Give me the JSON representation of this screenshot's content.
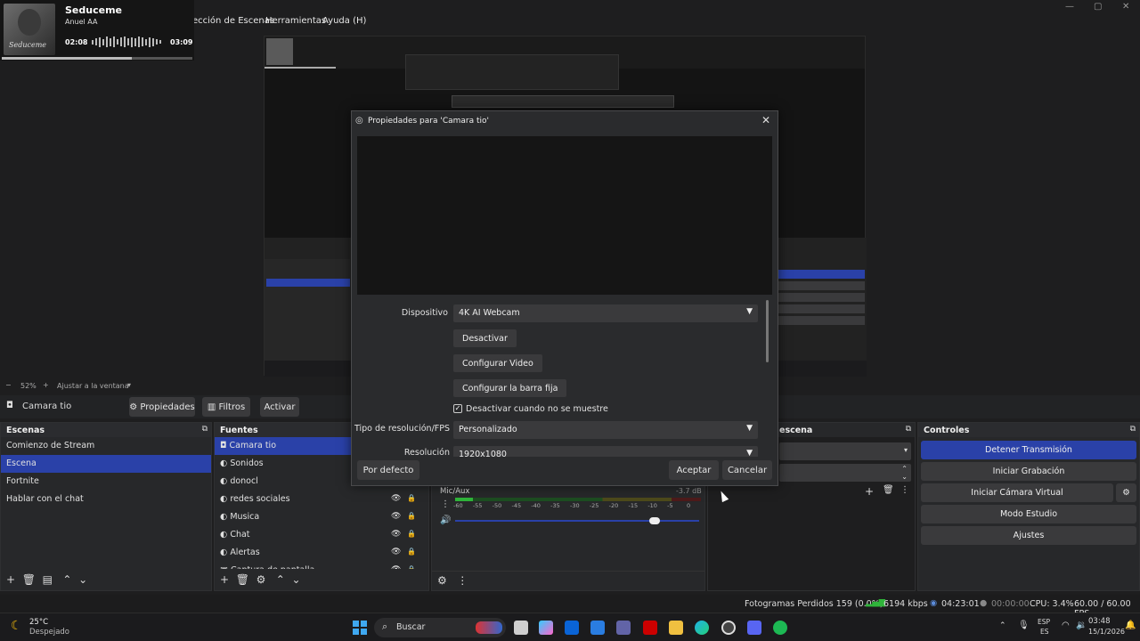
{
  "colors": {
    "accent": "#2a41a8",
    "bg": "#1e1e1f",
    "dock": "#27282a",
    "button": "#3a3a3c",
    "meter_green": "#2fb43a",
    "meter_yellow": "#c9b72b",
    "meter_red": "#c0392b"
  },
  "menubar": {
    "items": [
      "ección de Escenas",
      "Herramientas",
      "Ayuda (H)"
    ]
  },
  "music": {
    "title": "Seduceme",
    "artist": "Anuel AA",
    "elapsed": "02:08",
    "duration": "03:09",
    "progress": 0.68,
    "album_text": "Seduceme"
  },
  "preview": {
    "zoom": "52%",
    "fit_label": "Ajustar a la ventana"
  },
  "source_toolbar": {
    "source_name": "Camara tio",
    "properties": "Propiedades",
    "filters": "Filtros",
    "activate": "Activar"
  },
  "scenes": {
    "title": "Escenas",
    "items": [
      "Comienzo de Stream",
      "Escena",
      "Fortnite",
      "Hablar con el chat"
    ],
    "selected": 1
  },
  "sources": {
    "title": "Fuentes",
    "items": [
      "Camara tio",
      "Sonidos",
      "donocl",
      "redes sociales",
      "Musica",
      "Chat",
      "Alertas",
      "Captura de pantalla"
    ],
    "selected": 0
  },
  "mixer": {
    "channel": "Mic/Aux",
    "db": "-3.7 dB",
    "ticks": [
      "-60",
      "-55",
      "-50",
      "-45",
      "-40",
      "-35",
      "-30",
      "-25",
      "-20",
      "-15",
      "-10",
      "-5",
      "0"
    ]
  },
  "transitions": {
    "title": "escena"
  },
  "controls": {
    "title": "Controles",
    "buttons": [
      "Detener Transmisión",
      "Iniciar Grabación",
      "Iniciar Cámara Virtual",
      "Modo Estudio",
      "Ajustes"
    ]
  },
  "dialog": {
    "title": "Propiedades para 'Camara tio'",
    "device_label": "Dispositivo",
    "device_value": "4K AI Webcam",
    "deactivate": "Desactivar",
    "config_video": "Configurar Video",
    "config_bar": "Configurar la barra fija",
    "checkbox_label": "Desactivar cuando no se muestre",
    "res_type_label": "Tipo de resolución/FPS",
    "res_type_value": "Personalizado",
    "resolution_label": "Resolución",
    "resolution_value": "1920x1080",
    "defaults": "Por defecto",
    "accept": "Aceptar",
    "cancel": "Cancelar"
  },
  "status": {
    "dropped": "Fotogramas Perdidos 159 (0.0%)",
    "kbps": "6194 kbps",
    "stream_time": "04:23:01",
    "rec_time": "00:00:00",
    "cpu": "CPU: 3.4%",
    "fps": "60.00 / 60.00 FPS"
  },
  "taskbar": {
    "temp": "25°C",
    "weather": "Despejado",
    "search": "Buscar",
    "lang1": "ESP",
    "lang2": "ES",
    "time": "03:48",
    "date": "15/1/2026"
  }
}
